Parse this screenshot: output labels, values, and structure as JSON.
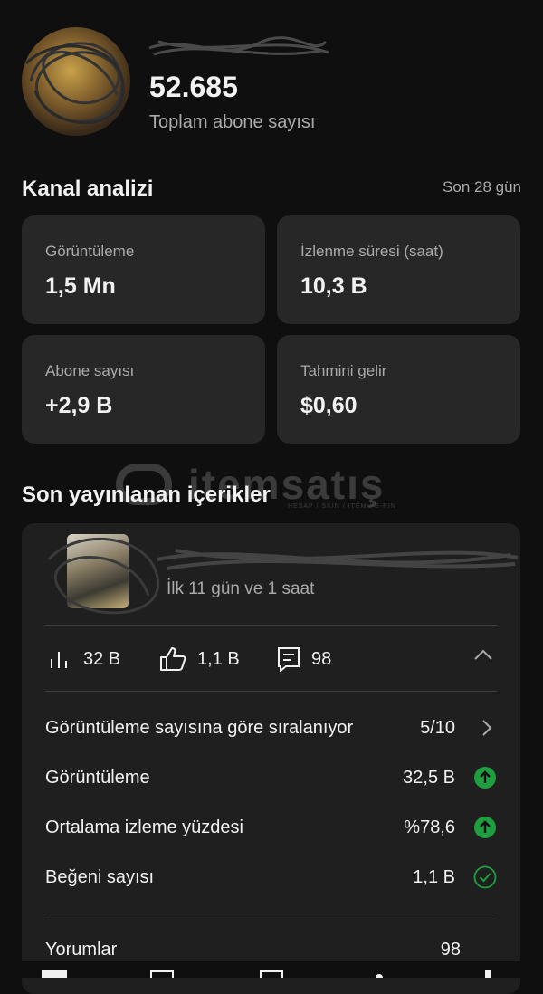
{
  "header": {
    "channel_name": "",
    "subscriber_count": "52.685",
    "subscriber_label": "Toplam abone sayısı"
  },
  "analytics": {
    "title": "Kanal analizi",
    "period": "Son 28 gün",
    "cards": [
      {
        "label": "Görüntüleme",
        "value": "1,5 Mn"
      },
      {
        "label": "İzlenme süresi (saat)",
        "value": "10,3 B"
      },
      {
        "label": "Abone sayısı",
        "value": "+2,9 B"
      },
      {
        "label": "Tahmini gelir",
        "value": "$0,60"
      }
    ]
  },
  "watermark": {
    "text": "itemsatış",
    "sub": "HESAP / SKIN / ITEM / E-PIN"
  },
  "recent": {
    "title": "Son yayınlanan içerikler",
    "video": {
      "title": "",
      "time": "İlk 11 gün ve 1 saat"
    },
    "stats": {
      "views": "32 B",
      "likes": "1,1 B",
      "comments": "98"
    },
    "rows": [
      {
        "label": "Görüntüleme sayısına göre sıralanıyor",
        "value": "5/10",
        "icon": "chevron-right-icon"
      },
      {
        "label": "Görüntüleme",
        "value": "32,5 B",
        "icon": "arrow-up-circle-icon"
      },
      {
        "label": "Ortalama izleme yüzdesi",
        "value": "%78,6",
        "icon": "arrow-up-circle-icon"
      },
      {
        "label": "Beğeni sayısı",
        "value": "1,1 B",
        "icon": "check-circle-icon"
      },
      {
        "label": "Yorumlar",
        "value": "98",
        "icon": ""
      }
    ]
  },
  "colors": {
    "background": "#0f0f0f",
    "card": "#272727",
    "accent_green": "#1e9e3e"
  }
}
